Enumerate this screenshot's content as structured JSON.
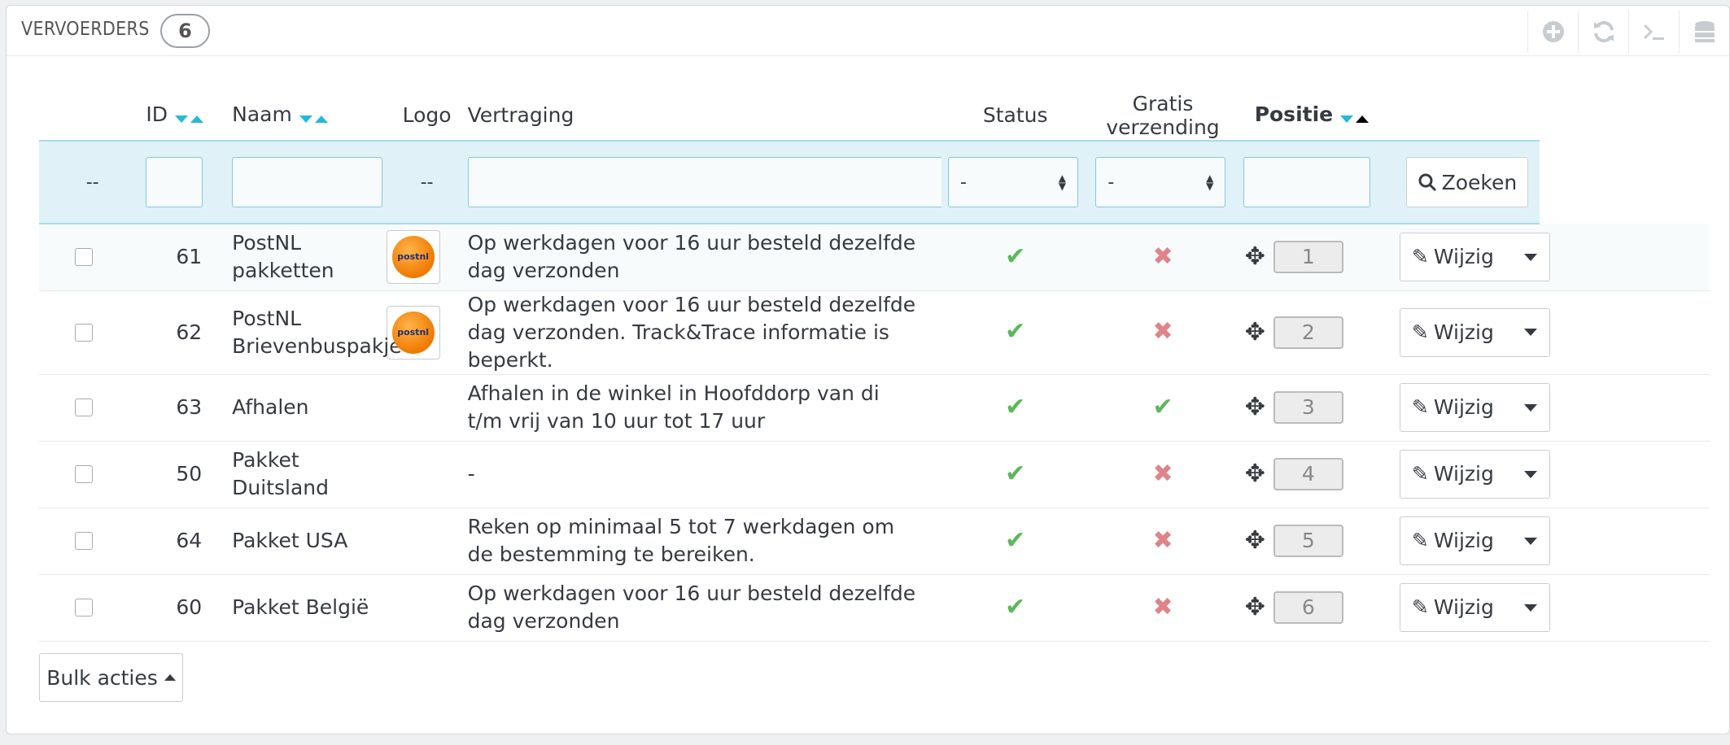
{
  "panel": {
    "title": "VERVOERDERS",
    "count": "6"
  },
  "toolbar": {
    "icons": [
      "add-icon",
      "refresh-icon",
      "terminal-icon",
      "database-icon"
    ]
  },
  "columns": {
    "id": "ID",
    "name": "Naam",
    "logo": "Logo",
    "delay": "Vertraging",
    "status": "Status",
    "free": "Gratis verzending",
    "position": "Positie"
  },
  "filters": {
    "bulk_placeholder": "--",
    "logo_placeholder": "--",
    "status_value": "-",
    "free_value": "-",
    "search_label": "Zoeken"
  },
  "rows": [
    {
      "id": "61",
      "name": "PostNL pakketten",
      "has_logo": true,
      "delay": "Op werkdagen voor 16 uur besteld dezelfde dag verzonden",
      "status": "ok",
      "free": "no",
      "position": "1"
    },
    {
      "id": "62",
      "name": "PostNL Brievenbuspakje",
      "has_logo": true,
      "delay": "Op werkdagen voor 16 uur besteld dezelfde dag verzonden. Track&Trace informatie is beperkt.",
      "status": "ok",
      "free": "no",
      "position": "2"
    },
    {
      "id": "63",
      "name": "Afhalen",
      "has_logo": false,
      "delay": "Afhalen in de winkel in Hoofddorp van di t/m vrij van 10 uur tot 17 uur",
      "status": "ok",
      "free": "ok",
      "position": "3"
    },
    {
      "id": "50",
      "name": "Pakket Duitsland",
      "has_logo": false,
      "delay": "-",
      "status": "ok",
      "free": "no",
      "position": "4"
    },
    {
      "id": "64",
      "name": "Pakket USA",
      "has_logo": false,
      "delay": "Reken op minimaal 5 tot 7 werkdagen om de bestemming te bereiken.",
      "status": "ok",
      "free": "no",
      "position": "5"
    },
    {
      "id": "60",
      "name": "Pakket België",
      "has_logo": false,
      "delay": "Op werkdagen voor 16 uur besteld dezelfde dag verzonden",
      "status": "ok",
      "free": "no",
      "position": "6"
    }
  ],
  "row_actions": {
    "edit_label": "Wijzig"
  },
  "logo_text": "postnl",
  "bulk": {
    "label": "Bulk acties"
  },
  "colors": {
    "accent": "#25b9d7",
    "ok": "#5cb85c",
    "no": "#e08388",
    "filter_bg": "#e0f2f8"
  }
}
